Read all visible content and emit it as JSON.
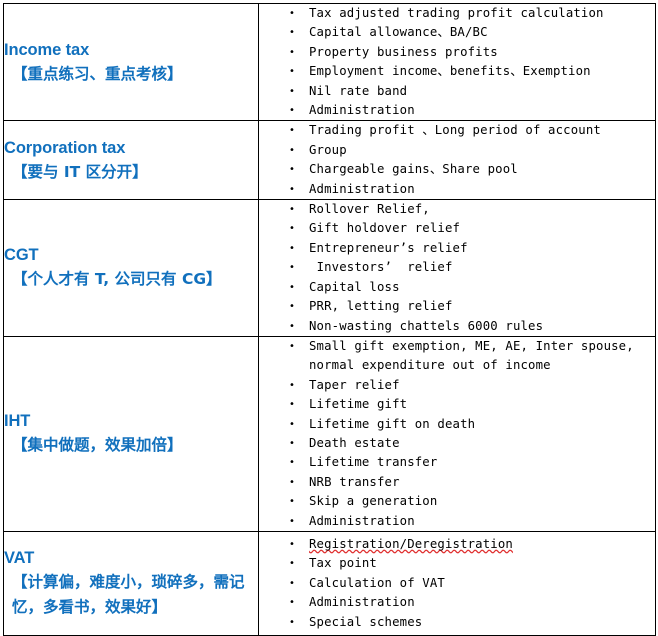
{
  "document": {
    "title": "Tax Topics Summary Table",
    "accent_color": "#1170BD",
    "text_color": "#000000",
    "border_color": "#000000",
    "spellcheck_underline_color": "#E03030",
    "bullet_glyph": "•"
  },
  "rows": [
    {
      "id": "income-tax",
      "topic_en": "Income tax",
      "topic_cn": "【重点练习、重点考核】",
      "points": [
        {
          "text": "Tax adjusted trading profit calculation",
          "spellcheck": false
        },
        {
          "text": "Capital allowance、BA/BC",
          "spellcheck": false
        },
        {
          "text": "Property business profits",
          "spellcheck": false
        },
        {
          "text": "Employment income、benefits、Exemption",
          "spellcheck": false
        },
        {
          "text": "Nil rate band",
          "spellcheck": false
        },
        {
          "text": "Administration",
          "spellcheck": false
        }
      ]
    },
    {
      "id": "corporation-tax",
      "topic_en": "Corporation tax",
      "topic_cn": "【要与 IT 区分开】",
      "points": [
        {
          "text": "Trading profit 、Long period of account",
          "spellcheck": false
        },
        {
          "text": "Group",
          "spellcheck": false
        },
        {
          "text": "Chargeable gains、Share pool",
          "spellcheck": false
        },
        {
          "text": "Administration",
          "spellcheck": false
        }
      ]
    },
    {
      "id": "cgt",
      "topic_en": "CGT",
      "topic_cn": "【个人才有 T, 公司只有 CG】",
      "points": [
        {
          "text": "Rollover Relief,",
          "spellcheck": false
        },
        {
          "text": "Gift holdover relief",
          "spellcheck": false
        },
        {
          "text": "Entrepreneur’s relief",
          "spellcheck": false
        },
        {
          "text": " Investors’  relief",
          "spellcheck": false
        },
        {
          "text": "Capital loss",
          "spellcheck": false
        },
        {
          "text": "PRR, letting relief",
          "spellcheck": false
        },
        {
          "text": "Non-wasting chattels 6000 rules",
          "spellcheck": false
        }
      ]
    },
    {
      "id": "iht",
      "topic_en": "IHT",
      "topic_cn": "【集中做题，效果加倍】",
      "points": [
        {
          "text": "Small gift exemption, ME, AE, Inter spouse, normal expenditure out of income",
          "spellcheck": false
        },
        {
          "text": "Taper relief",
          "spellcheck": false
        },
        {
          "text": "Lifetime gift",
          "spellcheck": false
        },
        {
          "text": "Lifetime gift on death",
          "spellcheck": false
        },
        {
          "text": "Death estate",
          "spellcheck": false
        },
        {
          "text": "Lifetime transfer",
          "spellcheck": false
        },
        {
          "text": "NRB transfer",
          "spellcheck": false
        },
        {
          "text": "Skip a generation",
          "spellcheck": false
        },
        {
          "text": "Administration",
          "spellcheck": false
        }
      ]
    },
    {
      "id": "vat",
      "topic_en": "VAT",
      "topic_cn": "【计算偏，难度小，琐碎多，需记忆，多看书，效果好】",
      "points": [
        {
          "text": "Registration/Deregistration",
          "spellcheck": true
        },
        {
          "text": "Tax point",
          "spellcheck": false
        },
        {
          "text": "Calculation of VAT",
          "spellcheck": false
        },
        {
          "text": "Administration",
          "spellcheck": false
        },
        {
          "text": "Special schemes",
          "spellcheck": false
        }
      ]
    }
  ]
}
